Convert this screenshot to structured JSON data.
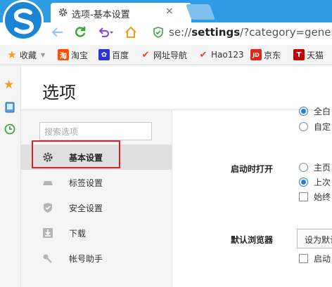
{
  "browser": {
    "tab_title": "选项-基本设置",
    "tab_close": "×",
    "address": {
      "prefix": "se://",
      "bold": "settings",
      "suffix": "/?category=general"
    },
    "accent": "#2e9be4"
  },
  "bookmarks": [
    {
      "label": "收藏",
      "icon": "star-icon"
    },
    {
      "label": "淘宝",
      "icon": "taobao-icon",
      "glyph": "淘",
      "color": "#ff5000"
    },
    {
      "label": "百度",
      "icon": "baidu-icon",
      "glyph": "✿",
      "color": "#2932e1"
    },
    {
      "label": "网址导航",
      "icon": "hao-icon",
      "glyph": "✔",
      "color": "#e43"
    },
    {
      "label": "Hao123",
      "icon": "hao123-icon",
      "glyph": "✔",
      "color": "#e43"
    },
    {
      "label": "京东",
      "icon": "jd-icon",
      "glyph": "JD",
      "color": "#e1251b"
    },
    {
      "label": "天猫",
      "icon": "tmall-icon",
      "glyph": "T",
      "color": "#c40000"
    }
  ],
  "settings": {
    "title": "选项",
    "search_placeholder": "搜索选项",
    "nav": [
      {
        "label": "基本设置",
        "icon": "gear-icon",
        "active": true
      },
      {
        "label": "标签设置",
        "icon": "tab-icon"
      },
      {
        "label": "安全设置",
        "icon": "shield-icon"
      },
      {
        "label": "下载",
        "icon": "download-icon"
      },
      {
        "label": "帐号助手",
        "icon": "key-icon"
      }
    ]
  },
  "content": {
    "top_options": [
      {
        "label": "全白",
        "checked": true
      },
      {
        "label": "自定",
        "checked": false
      }
    ],
    "startup": {
      "label": "启动时打开",
      "options": [
        {
          "label": "主页",
          "checked": false
        },
        {
          "label": "上次",
          "checked": true
        }
      ],
      "checkbox": "始终"
    },
    "default_browser": {
      "label": "默认浏览器",
      "button": "设为默认",
      "checkbox": "启动"
    }
  }
}
